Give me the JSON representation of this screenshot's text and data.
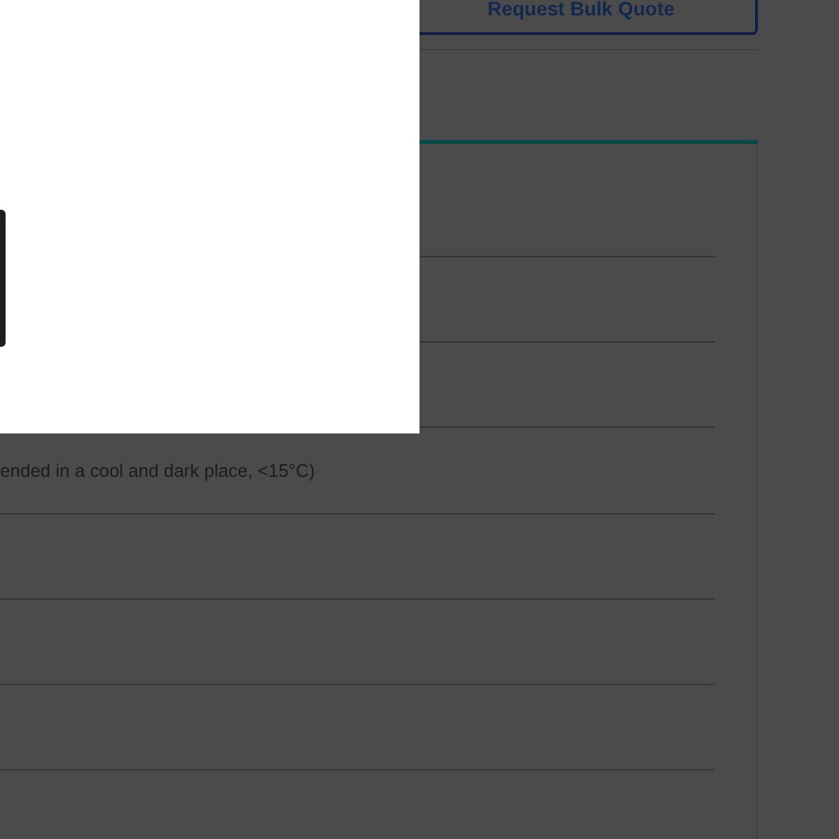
{
  "actions": {
    "bulk_quote_button": "Request Bulk Quote"
  },
  "details": {
    "storage_note": "ended in a cool and dark place, <15°C)"
  }
}
